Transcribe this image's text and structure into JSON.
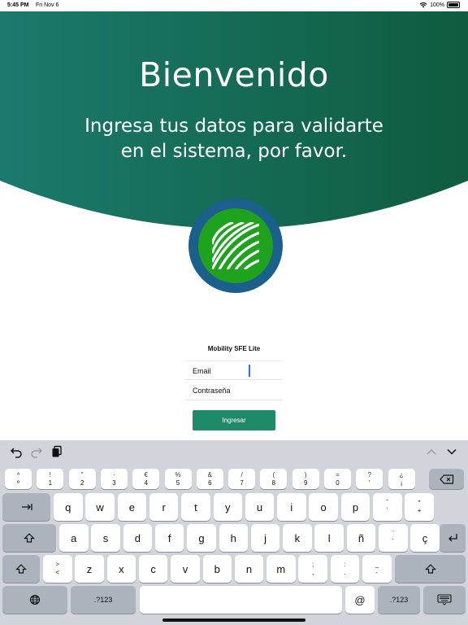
{
  "status_bar": {
    "time": "5:45 PM",
    "date": "Fri Nov 6",
    "battery": "100%",
    "battery_level": 1.0
  },
  "header": {
    "title": "Bienvenido",
    "subtitle_line1": "Ingresa tus datos para validarte",
    "subtitle_line2": "en el sistema, por favor."
  },
  "logo": {
    "icon": "stadium-lines-logo-icon",
    "ring_color": "#1b5f8d",
    "disc_color": "#1fa31f"
  },
  "form": {
    "app_name": "Mobility SFE Lite",
    "email_label": "Email",
    "password_label": "Contraseña",
    "submit_label": "Ingresar"
  },
  "colors": {
    "header_left": "#1b7a6c",
    "header_right": "#0f5c3f",
    "button": "#1e8a6a"
  },
  "keyboard": {
    "toolbar": {
      "undo_icon": "undo-icon",
      "redo_icon": "redo-icon",
      "paste_icon": "paste-icon",
      "up_icon": "chevron-up-icon",
      "down_icon": "chevron-down-icon"
    },
    "number_row": [
      {
        "top": "ª",
        "bottom": "º"
      },
      {
        "top": "!",
        "bottom": "1"
      },
      {
        "top": "\"",
        "bottom": "2"
      },
      {
        "top": "·",
        "bottom": "3"
      },
      {
        "top": "€",
        "bottom": "4"
      },
      {
        "top": "%",
        "bottom": "5"
      },
      {
        "top": "&",
        "bottom": "6"
      },
      {
        "top": "/",
        "bottom": "7"
      },
      {
        "top": "(",
        "bottom": "8"
      },
      {
        "top": ")",
        "bottom": "9"
      },
      {
        "top": "=",
        "bottom": "0"
      },
      {
        "top": "?",
        "bottom": "'"
      },
      {
        "top": "¿",
        "bottom": "¡"
      }
    ],
    "row_q": [
      "q",
      "w",
      "e",
      "r",
      "t",
      "y",
      "u",
      "i",
      "o",
      "p"
    ],
    "row_q_extra": [
      {
        "top": "ˆ",
        "bottom": "`"
      },
      {
        "top": "*",
        "bottom": "+"
      }
    ],
    "row_a": [
      "a",
      "s",
      "d",
      "f",
      "g",
      "h",
      "j",
      "k",
      "l",
      "ñ"
    ],
    "row_a_extra": [
      {
        "top": "¨",
        "bottom": "´"
      }
    ],
    "row_a_last": "ç",
    "row_z_first": {
      "top": ">",
      "bottom": "<"
    },
    "row_z": [
      "z",
      "x",
      "c",
      "v",
      "b",
      "n",
      "m"
    ],
    "row_z_extra": [
      {
        "top": ";",
        "bottom": ","
      },
      {
        "top": ":",
        "bottom": "."
      },
      {
        "top": "_",
        "bottom": "-"
      }
    ],
    "numeric_label": ".?123",
    "at_label": "@"
  }
}
